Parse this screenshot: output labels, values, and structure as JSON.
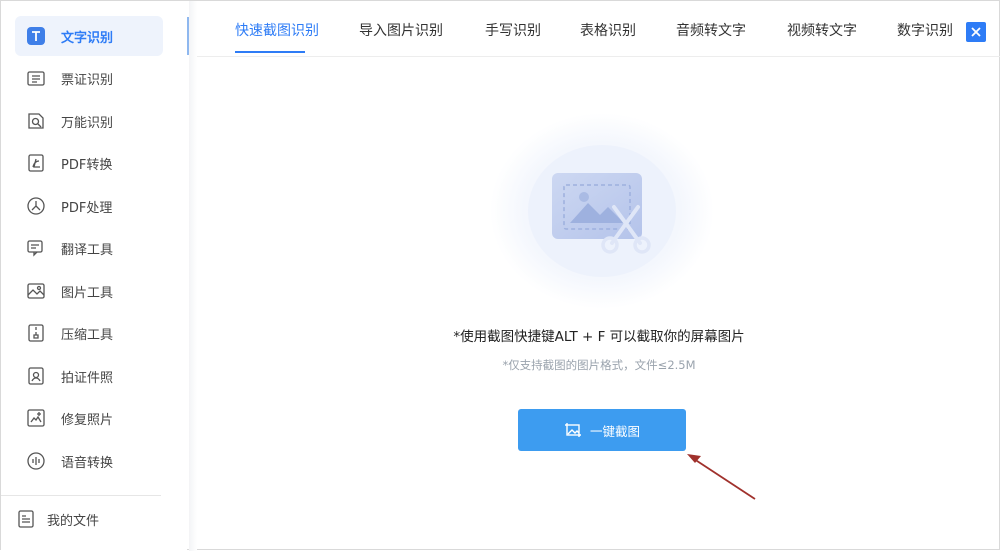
{
  "sidebar": {
    "items": [
      {
        "label": "文字识别",
        "icon": "text-recognition-icon",
        "active": true
      },
      {
        "label": "票证识别",
        "icon": "ticket-recognition-icon"
      },
      {
        "label": "万能识别",
        "icon": "universal-recognition-icon"
      },
      {
        "label": "PDF转换",
        "icon": "pdf-convert-icon"
      },
      {
        "label": "PDF处理",
        "icon": "pdf-process-icon"
      },
      {
        "label": "翻译工具",
        "icon": "translate-icon"
      },
      {
        "label": "图片工具",
        "icon": "image-tools-icon"
      },
      {
        "label": "压缩工具",
        "icon": "compress-icon"
      },
      {
        "label": "拍证件照",
        "icon": "id-photo-icon"
      },
      {
        "label": "修复照片",
        "icon": "repair-photo-icon"
      },
      {
        "label": "语音转换",
        "icon": "voice-convert-icon"
      }
    ],
    "my_files": {
      "label": "我的文件",
      "icon": "my-files-icon"
    }
  },
  "tabs": [
    {
      "label": "快速截图识别",
      "active": true
    },
    {
      "label": "导入图片识别"
    },
    {
      "label": "手写识别"
    },
    {
      "label": "表格识别"
    },
    {
      "label": "音频转文字"
    },
    {
      "label": "视频转文字"
    },
    {
      "label": "数字识别"
    }
  ],
  "main": {
    "hint": "*使用截图快捷键ALT + F 可以截取你的屏幕图片",
    "sub_hint": "*仅支持截图的图片格式，文件≤2.5M",
    "capture_button": "一键截图"
  },
  "colors": {
    "accent": "#2e7cf6",
    "button": "#3d9cf0",
    "arrow": "#a0312c"
  }
}
